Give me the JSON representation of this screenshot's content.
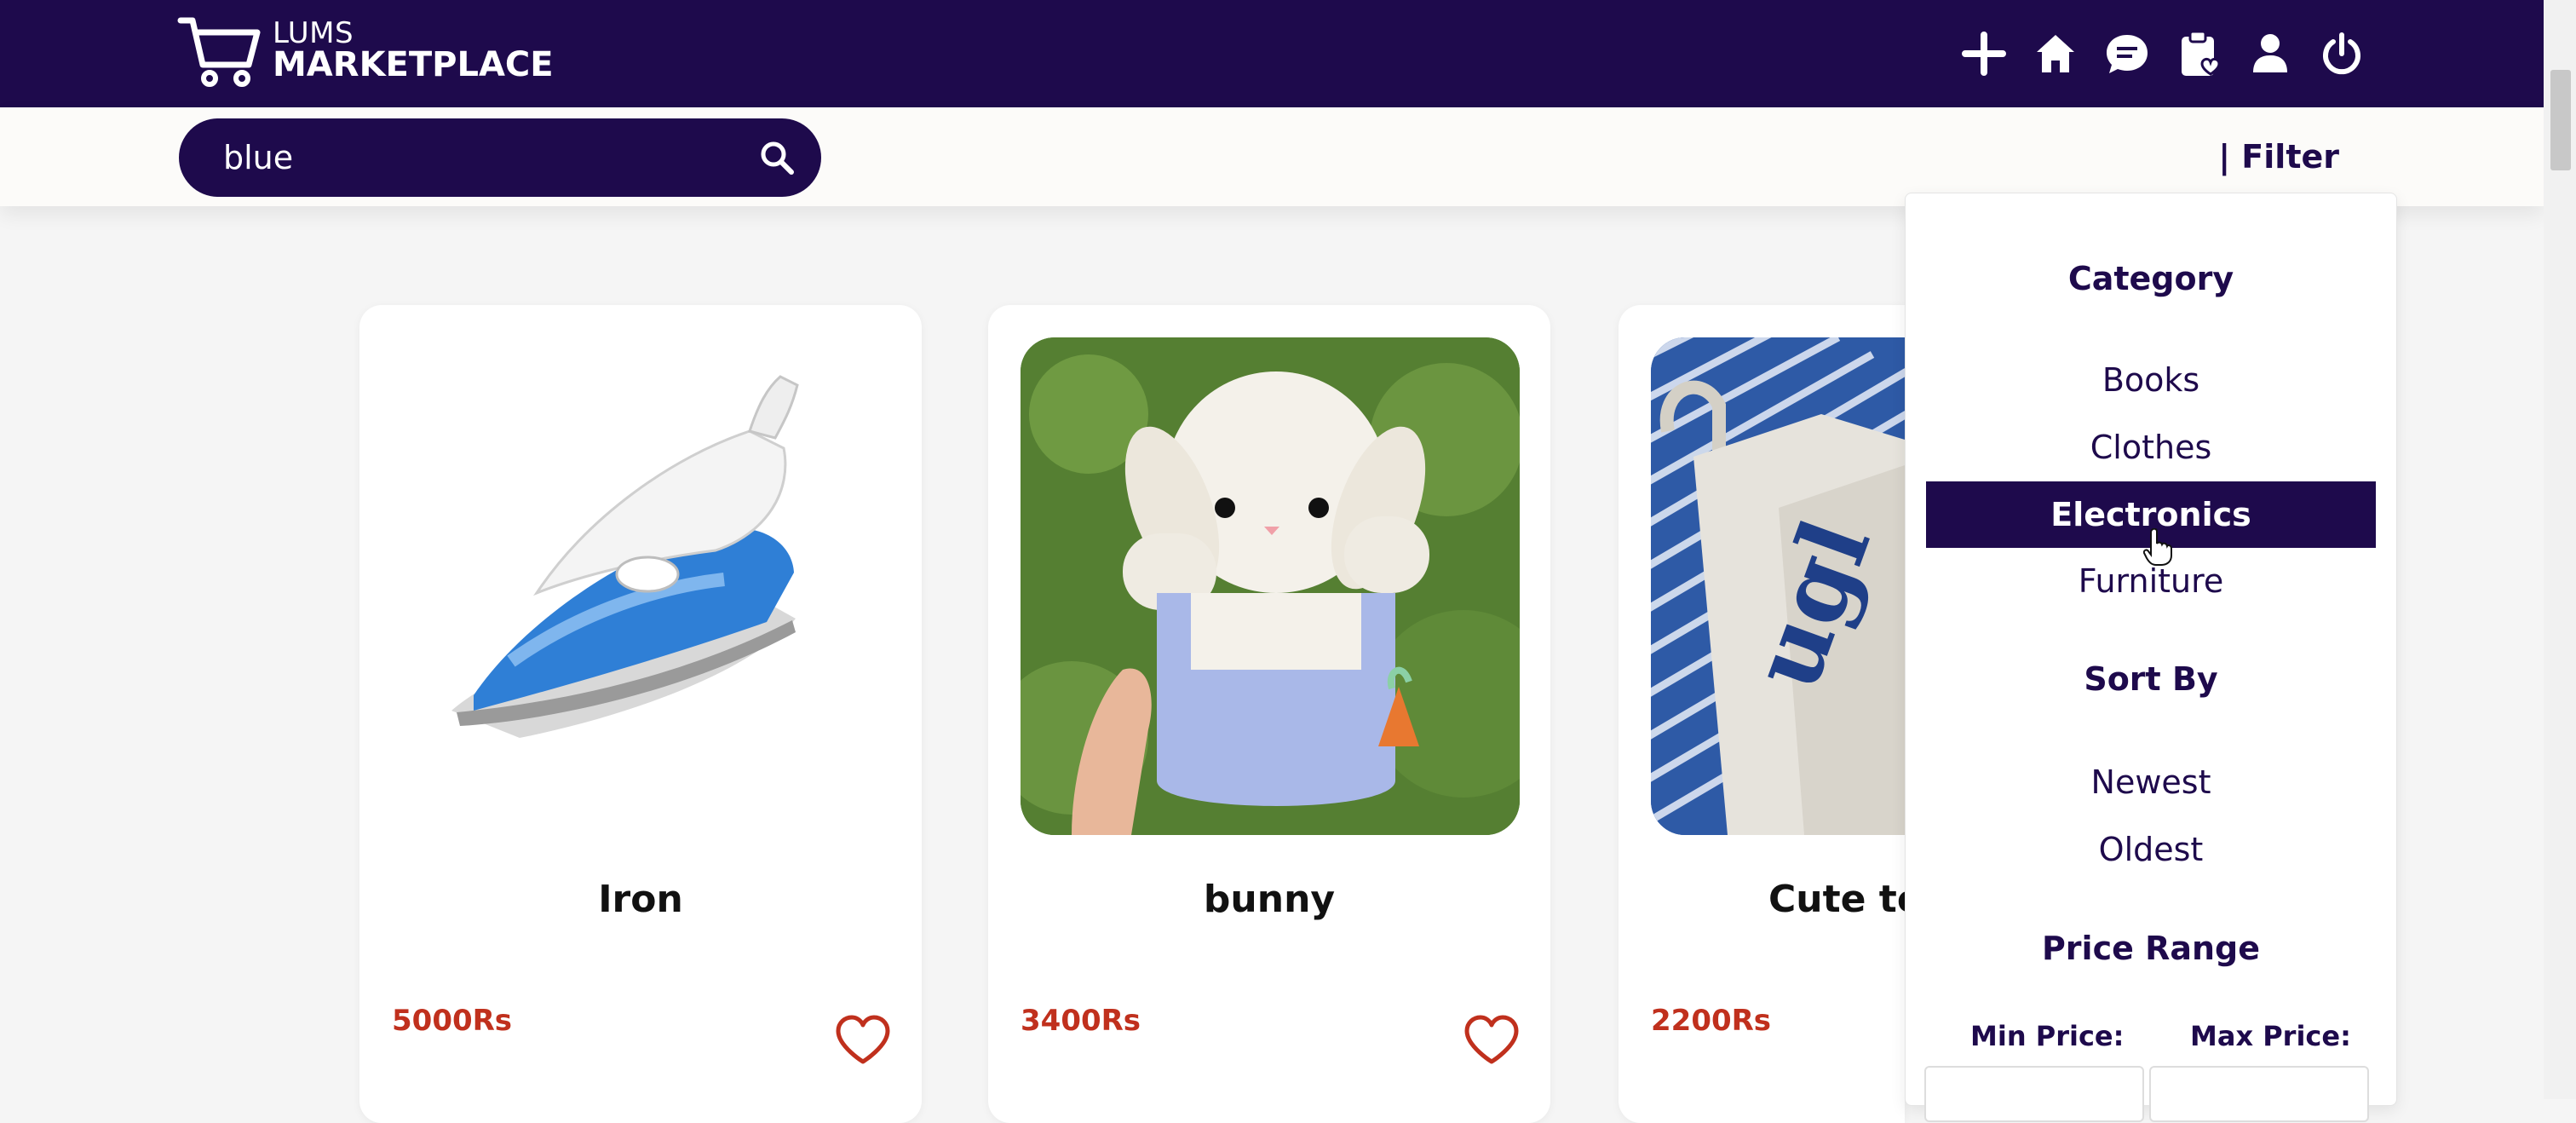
{
  "brand": {
    "line1": "LUMS",
    "line2": "MARKETPLACE"
  },
  "nav": {
    "icons": [
      "plus-icon",
      "home-icon",
      "chat-icon",
      "clipboard-icon",
      "user-icon",
      "power-icon"
    ]
  },
  "search": {
    "value": "blue",
    "placeholder": ""
  },
  "filter": {
    "toggle_label": "| Filter",
    "category_heading": "Category",
    "categories": [
      "Books",
      "Clothes",
      "Electronics",
      "Furniture"
    ],
    "active_category": "Electronics",
    "sort_heading": "Sort By",
    "sort_options": [
      "Newest",
      "Oldest"
    ],
    "price_heading": "Price Range",
    "min_label": "Min Price:",
    "max_label": "Max Price:"
  },
  "products": [
    {
      "title": "Iron",
      "price": "5000Rs"
    },
    {
      "title": "bunny",
      "price": "3400Rs"
    },
    {
      "title": "Cute to",
      "price": "2200Rs"
    }
  ],
  "colors": {
    "brand": "#1e0a4c",
    "price": "#c0301d",
    "background": "#f5f5f5"
  }
}
